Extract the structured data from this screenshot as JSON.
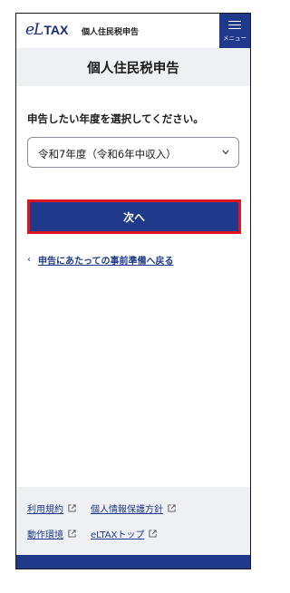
{
  "header": {
    "logo_mark": "eL",
    "logo_tax": "TAX",
    "site_title": "個人住民税申告",
    "menu_label": "メニュー"
  },
  "page": {
    "title": "個人住民税申告",
    "prompt": "申告したい年度を選択してください。",
    "year_select": {
      "selected": "令和7年度（令和6年中収入）"
    },
    "next_button": "次へ",
    "back_link": "申告にあたっての事前準備へ戻る"
  },
  "footer": {
    "links_row1": [
      "利用規約",
      "個人情報保護方針"
    ],
    "links_row2": [
      "動作環境",
      "eLTAXトップ"
    ]
  },
  "colors": {
    "primary": "#1f3a8a",
    "highlight_border": "#e0141e",
    "panel_bg": "#eef0f3"
  }
}
